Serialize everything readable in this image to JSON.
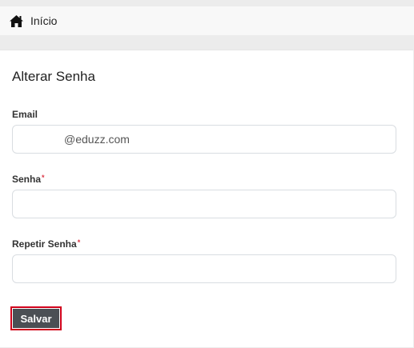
{
  "breadcrumb": {
    "home_label": "Início"
  },
  "form": {
    "title": "Alterar Senha",
    "email": {
      "label": "Email",
      "value": "@eduzz.com"
    },
    "password": {
      "label": "Senha",
      "required_mark": "*",
      "value": ""
    },
    "repeat_password": {
      "label": "Repetir Senha",
      "required_mark": "*",
      "value": ""
    },
    "save_label": "Salvar"
  },
  "colors": {
    "required": "#dc3545",
    "button": "#4b4f54",
    "highlight": "#d0021b"
  },
  "icons": {
    "home": "home-icon"
  }
}
